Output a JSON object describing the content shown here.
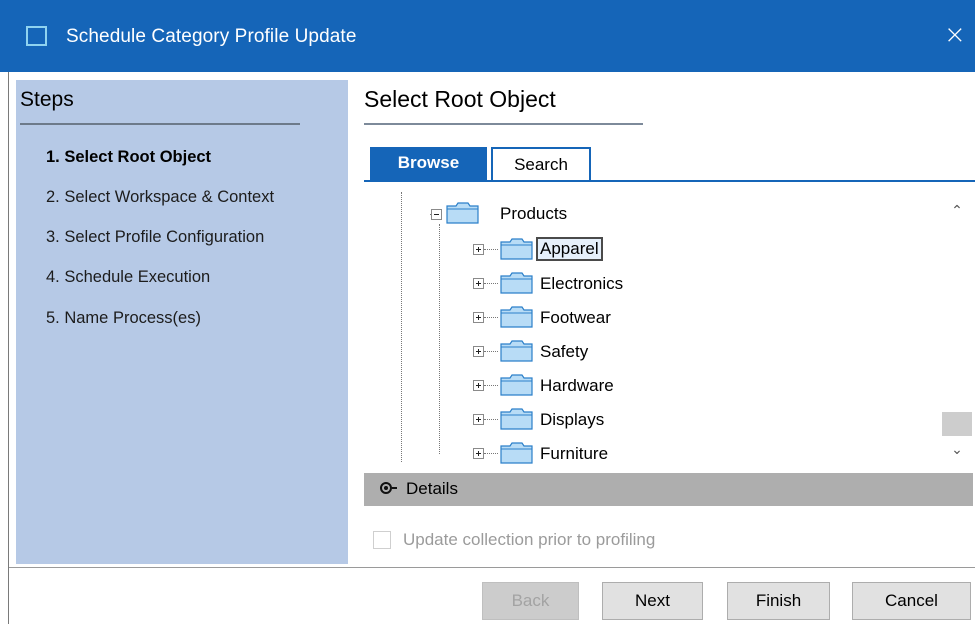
{
  "window": {
    "title": "Schedule Category Profile Update",
    "close_icon": "×",
    "colors": {
      "titlebar": "#1565b8",
      "steps_panel": "#b6c9e6",
      "details_bar": "#aeaeae"
    }
  },
  "steps": {
    "title": "Steps",
    "items": [
      {
        "label": "1. Select Root Object",
        "active": true
      },
      {
        "label": "2. Select Workspace & Context",
        "active": false
      },
      {
        "label": "3. Select Profile Configuration",
        "active": false
      },
      {
        "label": "4. Schedule Execution",
        "active": false
      },
      {
        "label": "5. Name Process(es)",
        "active": false
      }
    ]
  },
  "main": {
    "title": "Select Root Object",
    "tabs": [
      {
        "label": "Browse",
        "active": true
      },
      {
        "label": "Search",
        "active": false
      }
    ],
    "tree": {
      "root": {
        "label": "Products",
        "expanded": true,
        "icon": "folder-icon"
      },
      "children": [
        {
          "label": "Apparel",
          "selected": true
        },
        {
          "label": "Electronics",
          "selected": false
        },
        {
          "label": "Footwear",
          "selected": false
        },
        {
          "label": "Safety",
          "selected": false
        },
        {
          "label": "Hardware",
          "selected": false
        },
        {
          "label": "Displays",
          "selected": false
        },
        {
          "label": "Furniture",
          "selected": false
        }
      ]
    },
    "details_label": "Details",
    "checkbox": {
      "label": "Update collection prior to profiling",
      "checked": false,
      "enabled": false
    }
  },
  "footer": {
    "buttons": [
      {
        "label": "Back",
        "enabled": false
      },
      {
        "label": "Next",
        "enabled": true
      },
      {
        "label": "Finish",
        "enabled": true
      },
      {
        "label": "Cancel",
        "enabled": true
      }
    ]
  }
}
